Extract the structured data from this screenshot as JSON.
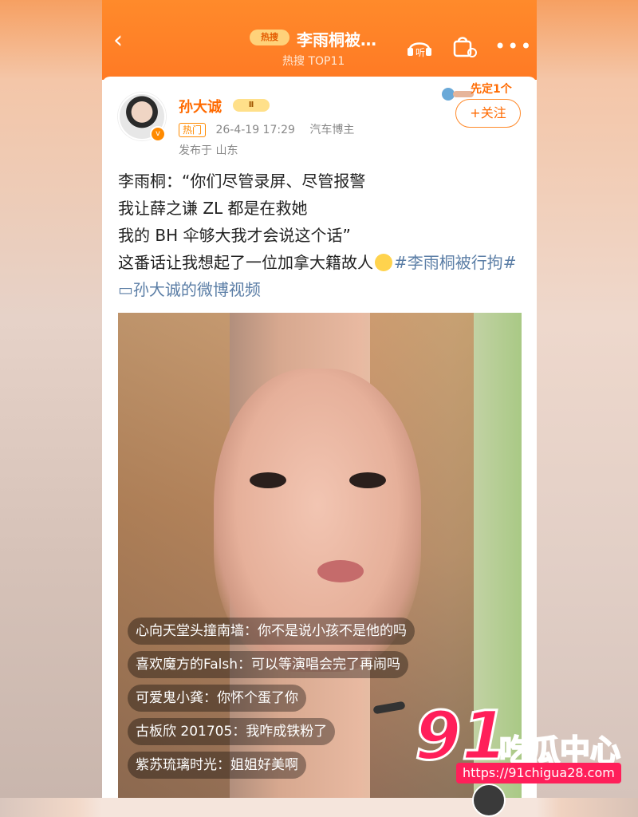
{
  "header": {
    "back_icon": "chevron-left-icon",
    "hot_tag": "热搜",
    "title": "李雨桐被…",
    "subtitle": "热搜 TOP11",
    "listen_label": "听",
    "icons": [
      "headphones-icon",
      "bag-icon",
      "more-icon"
    ]
  },
  "post": {
    "author": "孙大诚",
    "vip_badge": "Ⅱ",
    "hot_chip": "热门",
    "datetime": "26-4-19 17:29",
    "tag": "汽车博主",
    "location": "发布于 山东",
    "sticker_text": "先定1个",
    "follow_label": "+关注",
    "lines": [
      "李雨桐：“你们尽管录屏、尽管报警",
      "我让薛之谦 ZL 都是在救她",
      "我的 BH 伞够大我才会说这个话”"
    ],
    "line4_prefix": "这番话让我想起了一位加拿大籍故人",
    "hashtag": "#李雨桐被行拘#",
    "video_link": "孙大诚的微博视频"
  },
  "video": {
    "comments": [
      "心向天堂头撞南墙：你不是说小孩不是他的吗",
      "喜欢魔方的Falsh：可以等演唱会完了再闹吗",
      "可爱鬼小龚：你怀个蛋了你",
      "古板欣 201705：我咋成铁粉了",
      "紫苏琉璃时光：姐姐好美啊"
    ]
  },
  "watermark": {
    "number": "91",
    "text": "吃瓜中心",
    "url": "https://91chigua28.com"
  }
}
